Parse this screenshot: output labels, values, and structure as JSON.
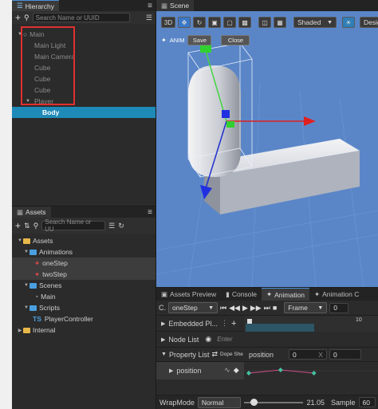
{
  "hierarchy": {
    "title": "Hierarchy",
    "search_placeholder": "Search Name or UUID",
    "nodes": [
      "Main",
      "Main Light",
      "Main Camera",
      "Cube",
      "Cube",
      "Cube",
      "Player",
      "Body"
    ]
  },
  "assets": {
    "title": "Assets",
    "search_placeholder": "Search Name or UU",
    "items": [
      "Assets",
      "Animations",
      "oneStep",
      "twoStep",
      "Scenes",
      "Main",
      "Scripts",
      "PlayerController",
      "Internal"
    ],
    "ts_badge": "TS"
  },
  "scene": {
    "title": "Scene",
    "mode_3d": "3D",
    "shading": "Shaded",
    "design": "Design",
    "anim_label": "ANIM",
    "save_label": "Save",
    "close_label": "Close"
  },
  "bottom_tabs": [
    "Assets Preview",
    "Console",
    "Animation",
    "Animation C"
  ],
  "animation": {
    "clip_prefix": "C.",
    "clip_value": "oneStep",
    "frame_mode": "Frame",
    "frame_value": "0",
    "embedded_label": "Embedded Pl...",
    "timeline_tick": "10",
    "node_list_label": "Node List",
    "node_input_placeholder": "Enter",
    "property_list_label": "Property List",
    "dope_label": "Dope She",
    "position_field_label": "position",
    "x_value": "0",
    "x_axis": "X",
    "y_value": "0",
    "position_track": "position",
    "wrapmode_label": "WrapMode",
    "wrapmode_value": "Normal",
    "speed_value": "21.05",
    "sample_label": "Sample",
    "sample_value": "60"
  },
  "colors": {
    "selection": "#1e8ab7",
    "highlight_box": "#e03030",
    "sky": "#5a86c8",
    "accent": "#4a90d9"
  }
}
